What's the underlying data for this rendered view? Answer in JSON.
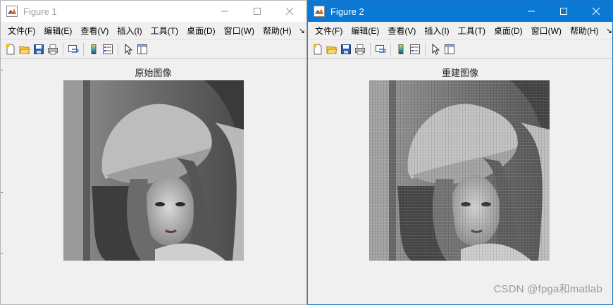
{
  "menu": [
    "文件(F)",
    "编辑(E)",
    "查看(V)",
    "插入(I)",
    "工具(T)",
    "桌面(D)",
    "窗口(W)",
    "帮助(H)"
  ],
  "menu_overflow": "↘",
  "toolbar_icons": [
    "new-figure-icon",
    "open-file-icon",
    "save-icon",
    "print-icon",
    "link-plot-icon",
    "insert-colorbar-icon",
    "insert-legend-icon",
    "edit-plot-arrow-icon",
    "property-inspector-icon"
  ],
  "figure1": {
    "title": "Figure 1",
    "axes_title": "原始图像",
    "image_label": "grayscale portrait photo (original)"
  },
  "figure2": {
    "title": "Figure 2",
    "axes_title": "重建图像",
    "image_label": "grayscale portrait photo (reconstructed, blocky)"
  },
  "watermark": "CSDN @fpga和matlab",
  "colors": {
    "active_titlebar": "#0a79d6",
    "window_bg": "#f0f0f0"
  }
}
